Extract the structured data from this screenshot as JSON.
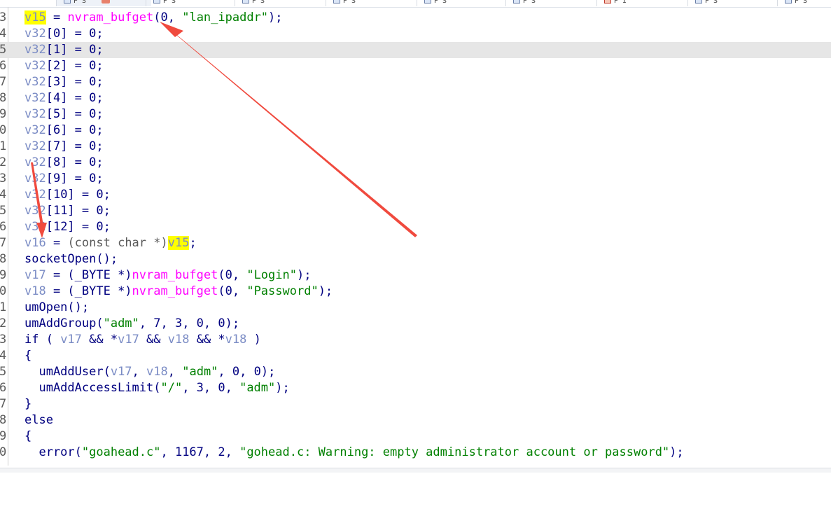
{
  "tabs": [
    {
      "label": "P S",
      "active": true,
      "icon": "pseudocode-tab-icon"
    },
    {
      "label": "P S",
      "icon": "pseudocode-tab-icon"
    },
    {
      "label": "P S",
      "icon": "pseudocode-tab-icon"
    },
    {
      "label": "P S",
      "icon": "pseudocode-tab-icon"
    },
    {
      "label": "P S",
      "icon": "pseudocode-tab-icon"
    },
    {
      "label": "P S",
      "icon": "pseudocode-tab-icon"
    },
    {
      "label": "P I",
      "icon": "hex-tab-icon"
    },
    {
      "label": "P S",
      "icon": "pseudocode-tab-icon"
    },
    {
      "label": "P S",
      "icon": "pseudocode-tab-icon"
    }
  ],
  "line_numbers": [
    "3",
    "4",
    "5",
    "6",
    "7",
    "8",
    "9",
    "0",
    "1",
    "2",
    "3",
    "4",
    "5",
    "6",
    "7",
    "8",
    "9",
    "0",
    "1",
    "2",
    "3",
    "4",
    "5",
    "6",
    "7",
    "8",
    "9",
    "0"
  ],
  "code": {
    "l0": {
      "a": "v15",
      "b": " = ",
      "c": "nvram_bufget",
      "d": "(0, ",
      "e": "\"lan_ipaddr\"",
      "f": ");"
    },
    "l1": {
      "a": "v32",
      "b": "[0] = 0;"
    },
    "l2": {
      "a": "v32",
      "b": "[1] = 0;"
    },
    "l3": {
      "a": "v32",
      "b": "[2] = 0;"
    },
    "l4": {
      "a": "v32",
      "b": "[3] = 0;"
    },
    "l5": {
      "a": "v32",
      "b": "[4] = 0;"
    },
    "l6": {
      "a": "v32",
      "b": "[5] = 0;"
    },
    "l7": {
      "a": "v32",
      "b": "[6] = 0;"
    },
    "l8": {
      "a": "v32",
      "b": "[7] = 0;"
    },
    "l9": {
      "a": "v32",
      "b": "[8] = 0;"
    },
    "l10": {
      "a": "v32",
      "b": "[9] = 0;"
    },
    "l11": {
      "a": "v32",
      "b": "[10] = 0;"
    },
    "l12": {
      "a": "v32",
      "b": "[11] = 0;"
    },
    "l13": {
      "a": "v32",
      "b": "[12] = 0;"
    },
    "l14": {
      "a": "v16",
      "b": " = ",
      "c": "(const char *)",
      "d": "v15",
      "e": ";"
    },
    "l15": {
      "a": "socketOpen();"
    },
    "l16": {
      "a": "v17",
      "b": " = (_BYTE *)",
      "c": "nvram_bufget",
      "d": "(0, ",
      "e": "\"Login\"",
      "f": ");"
    },
    "l17": {
      "a": "v18",
      "b": " = (_BYTE *)",
      "c": "nvram_bufget",
      "d": "(0, ",
      "e": "\"Password\"",
      "f": ");"
    },
    "l18": {
      "a": "umOpen();"
    },
    "l19": {
      "a": "umAddGroup(",
      "b": "\"adm\"",
      "c": ", 7, 3, 0, 0);"
    },
    "l20": {
      "a": "if ( ",
      "b": "v17",
      "c": " && *",
      "d": "v17",
      "e": " && ",
      "f": "v18",
      "g": " && *",
      "h": "v18",
      "i": " )"
    },
    "l21": {
      "a": "{"
    },
    "l22": {
      "a": "  umAddUser(",
      "b": "v17",
      "c": ", ",
      "d": "v18",
      "e": ", ",
      "f": "\"adm\"",
      "g": ", 0, 0);"
    },
    "l23": {
      "a": "  umAddAccessLimit(",
      "b": "\"/\"",
      "c": ", 3, 0, ",
      "d": "\"adm\"",
      "e": ");"
    },
    "l24": {
      "a": "}"
    },
    "l25": {
      "a": "else"
    },
    "l26": {
      "a": "{"
    },
    "l27": {
      "a": "  error(",
      "b": "\"goahead.c\"",
      "c": ", 1167, 2, ",
      "d": "\"gohead.c: Warning: empty administrator account or password\"",
      "e": ");"
    }
  },
  "colors": {
    "variable": "#7b8cc5",
    "function_import": "#ff00ff",
    "string": "#008000",
    "identifier": "#000080",
    "highlight": "#ffff00",
    "current_line": "#e6e6e6",
    "annotation_arrow": "#f04a3e"
  }
}
